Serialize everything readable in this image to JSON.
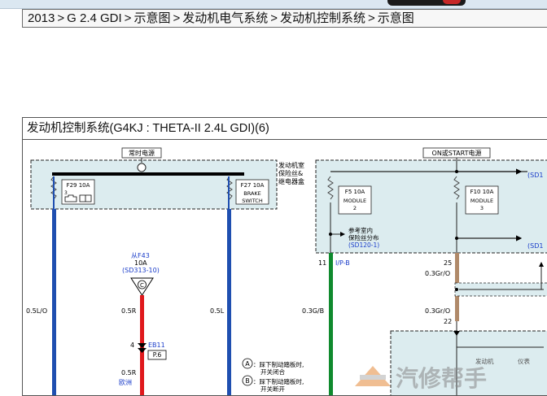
{
  "breadcrumb": [
    "2013",
    "G 2.4 GDI",
    "示意图",
    "发动机电气系统",
    "发动机控制系统",
    "示意图"
  ],
  "breadcrumb_separator": ">",
  "diagram": {
    "title": "发动机控制系统(G4KJ : THETA-II 2.4L GDI)(6)",
    "left_box": {
      "header": "常时电源",
      "box_label": [
        "发动机室",
        "保险丝&",
        "继电器盒"
      ],
      "fuses": [
        {
          "name": "F29 10A",
          "sub": "3",
          "wire": "0.5L/O"
        },
        {
          "name": "F27 10A",
          "sub_lines": [
            "BRAKE",
            "SWITCH"
          ],
          "wire": "0.5L"
        }
      ]
    },
    "right_box": {
      "header": "ON或START电源",
      "fuses": [
        {
          "name": "F5 10A",
          "sub_lines": [
            "MODULE",
            "2"
          ]
        },
        {
          "name": "F10 10A",
          "sub_lines": [
            "MODULE",
            "3"
          ]
        }
      ],
      "ref_note": [
        "参考室内",
        "保险丝分布"
      ],
      "ref_code": "(SD120-1)",
      "ref_right_1": "(SD1",
      "ref_right_2": "(SD1"
    },
    "from_label": "从F43",
    "from_amp": "10A",
    "from_ref": "(SD313-10)",
    "splice": "C",
    "wire_0_5R": "0.5R",
    "connector_pin": "4",
    "connector_name": "EB11",
    "connector_sub": "P.6",
    "wire_0_5R_2": "0.5R",
    "region": "欧洲",
    "pin_11": "11",
    "pin_11_label": "I/P-B",
    "pin_25": "25",
    "pin_22": "22",
    "wire_GB": "0.3G/B",
    "wire_GrO_1": "0.3Gr/O",
    "wire_GrO_2": "0.3Gr/O",
    "notes": [
      {
        "mark": "A",
        "lines": [
          "：踩下制动踏板时,",
          "开关闭合"
        ]
      },
      {
        "mark": "B",
        "lines": [
          "：踩下制动踏板时,",
          "开关断开"
        ]
      }
    ],
    "lower_box_labels": [
      "发动机",
      "仪表"
    ],
    "watermark": "汽修帮手",
    "colors": {
      "box_fill": "#dcecef",
      "wire_blue": "#1f4fb0",
      "wire_red": "#e0191d",
      "wire_green": "#0f8a2e",
      "wire_tan": "#b08a6a",
      "ref_text": "#1a3cc9"
    }
  }
}
